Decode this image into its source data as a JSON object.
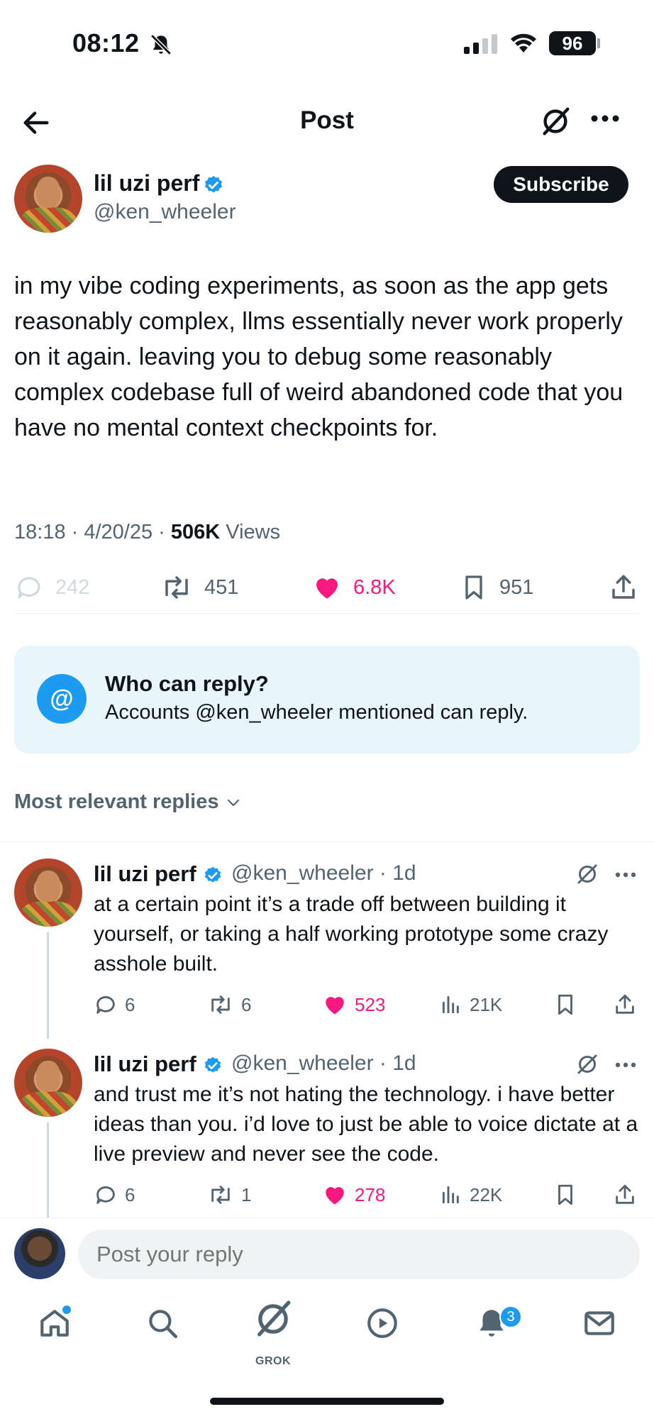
{
  "status_bar": {
    "time": "08:12",
    "battery": "96"
  },
  "header": {
    "title": "Post"
  },
  "post": {
    "author_name": "lil uzi perf",
    "author_handle": "@ken_wheeler",
    "subscribe_label": "Subscribe",
    "text": "in my vibe coding experiments, as soon as the app gets reasonably complex, llms essentially never work properly on it again. leaving you to debug some reasonably complex codebase full of weird abandoned code that you have no mental context checkpoints for.",
    "time": "18:18",
    "date": "4/20/25",
    "views_count": "506K",
    "views_label": "Views",
    "replies": "242",
    "reposts": "451",
    "likes": "6.8K",
    "bookmarks": "951"
  },
  "who_can_reply": {
    "title": "Who can reply?",
    "text": "Accounts @ken_wheeler mentioned can reply."
  },
  "replies_sort": {
    "label": "Most relevant replies"
  },
  "replies": [
    {
      "name": "lil uzi perf",
      "handle": "@ken_wheeler",
      "age": "1d",
      "text": "at a certain point it’s a trade off between building it yourself, or taking a half working prototype some crazy asshole built.",
      "replies": "6",
      "reposts": "6",
      "likes": "523",
      "views": "21K"
    },
    {
      "name": "lil uzi perf",
      "handle": "@ken_wheeler",
      "age": "1d",
      "text": "and trust me it’s not hating the technology. i have better ideas than you. i’d love to just be able to voice dictate at a live preview and never see the code.",
      "replies": "6",
      "reposts": "1",
      "likes": "278",
      "views": "22K"
    }
  ],
  "compose": {
    "placeholder": "Post your reply"
  },
  "nav": {
    "grok_label": "GROK",
    "notifications_badge": "3"
  },
  "colors": {
    "accent": "#1d9bf0",
    "like": "#f91880",
    "text": "#0f1419",
    "muted": "#536471"
  }
}
